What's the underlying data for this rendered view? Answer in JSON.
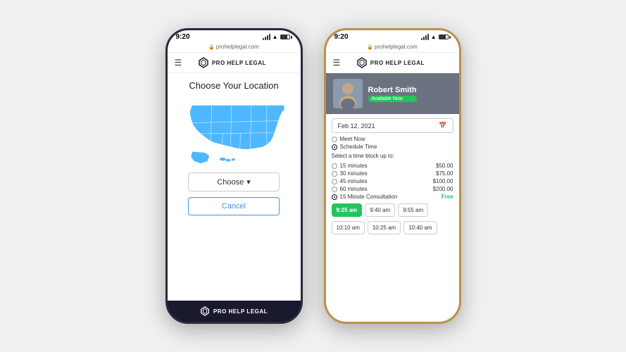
{
  "phone1": {
    "status_time": "9:20",
    "url": "prohelplegal.com",
    "nav": {
      "logo_text": "PRO HELP LEGAL"
    },
    "main": {
      "title": "Choose Your Location",
      "choose_label": "Choose",
      "cancel_label": "Cancel"
    },
    "footer": {
      "logo_text": "PRO HELP LEGAL"
    }
  },
  "phone2": {
    "status_time": "9:20",
    "url": "prohelplegal.com",
    "nav": {
      "logo_text": "PRO HELP LEGAL"
    },
    "lawyer": {
      "name": "Robert Smith",
      "availability": "Available Now"
    },
    "booking": {
      "date": "Feb 12, 2021",
      "meet_now": "Meet Now",
      "schedule_time": "Schedule Time",
      "select_label": "Select a time block up to:",
      "options": [
        {
          "label": "15 minutes",
          "price": "$50.00"
        },
        {
          "label": "30 minutes",
          "price": "$75.00"
        },
        {
          "label": "45 minutes",
          "price": "$100.00"
        },
        {
          "label": "60 minutes",
          "price": "$200.00"
        },
        {
          "label": "15 Minute Consultation",
          "price": "Free"
        }
      ],
      "time_slots_row1": [
        "9:25 am",
        "9:40 am",
        "9:55 am"
      ],
      "time_slots_row2": [
        "10:10 am",
        "10:25 am",
        "10:40 am"
      ]
    }
  }
}
